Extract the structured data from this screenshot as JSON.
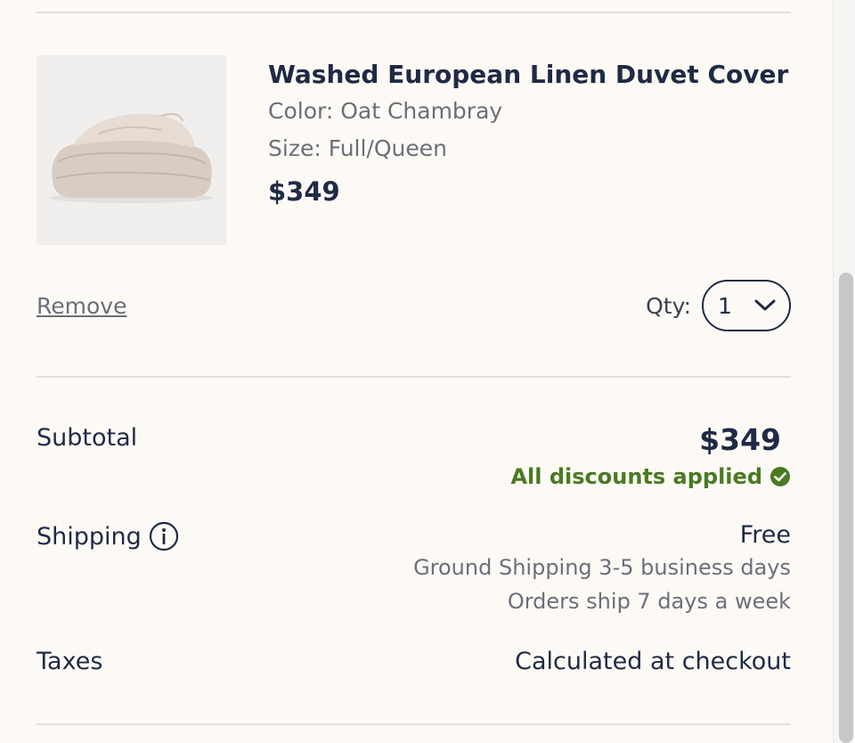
{
  "cart_item": {
    "name": "Washed European Linen Duvet Cover",
    "color": "Color: Oat Chambray",
    "size": "Size: Full/Queen",
    "price": "$349",
    "image_icon": "duvet-product-image",
    "remove_label": "Remove",
    "qty_label": "Qty:",
    "qty_value": "1"
  },
  "summary": {
    "subtotal_label": "Subtotal",
    "subtotal_value": "$349",
    "discount_text": "All discounts applied",
    "shipping_label": "Shipping",
    "shipping_value": "Free",
    "shipping_note_1": "Ground Shipping 3-5 business days",
    "shipping_note_2": "Orders ship 7 days a week",
    "taxes_label": "Taxes",
    "taxes_value": "Calculated at checkout"
  },
  "colors": {
    "text_primary": "#1f2a44",
    "text_secondary": "#6b6f78",
    "discount_green": "#4a7a22",
    "background": "#fdfaf6"
  }
}
